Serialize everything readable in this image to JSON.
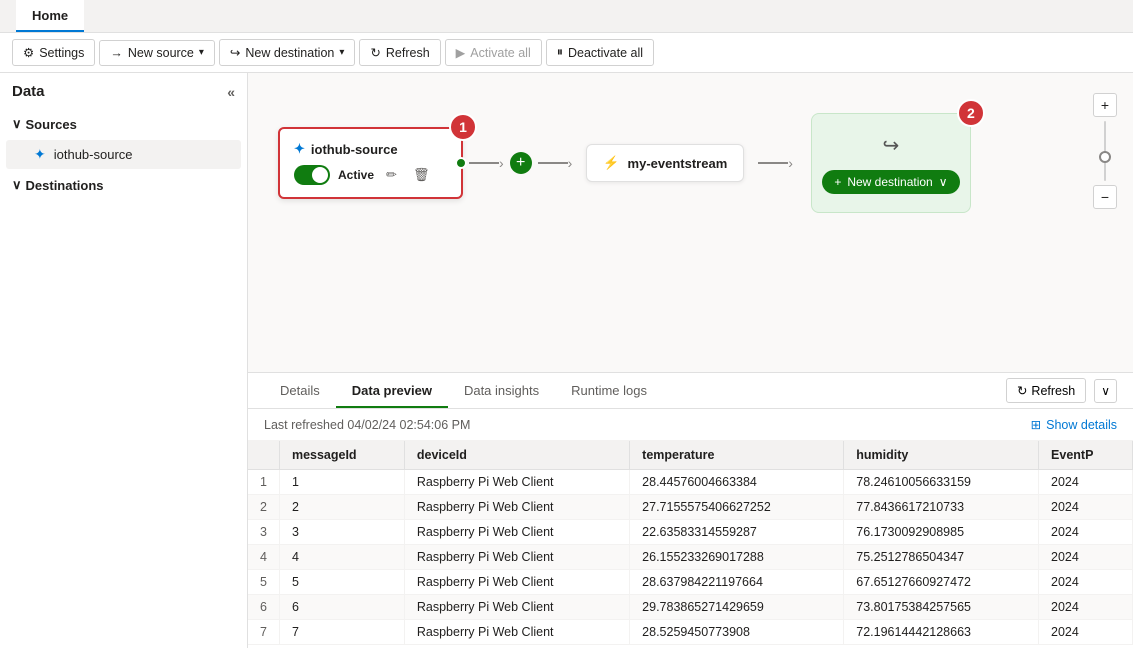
{
  "tab": {
    "label": "Home"
  },
  "toolbar": {
    "settings_label": "Settings",
    "new_source_label": "New source",
    "new_destination_label": "New destination",
    "refresh_label": "Refresh",
    "activate_all_label": "Activate all",
    "deactivate_all_label": "Deactivate all"
  },
  "sidebar": {
    "title": "Data",
    "sources_label": "Sources",
    "destinations_label": "Destinations",
    "source_item": "iothub-source"
  },
  "canvas": {
    "source_node": {
      "title": "iothub-source",
      "status": "Active",
      "step": "1"
    },
    "eventstream_node": {
      "title": "my-eventstream"
    },
    "destination_node": {
      "new_dest_label": "New destination"
    },
    "step2_label": "2"
  },
  "bottom_panel": {
    "tabs": [
      "Details",
      "Data preview",
      "Data insights",
      "Runtime logs"
    ],
    "active_tab": "Data preview",
    "refresh_label": "Refresh",
    "show_details_label": "Show details",
    "last_refreshed": "Last refreshed  04/02/24 02:54:06 PM",
    "columns": [
      "messageId",
      "deviceId",
      "temperature",
      "humidity",
      "EventP"
    ],
    "rows": [
      {
        "messageId": "1",
        "deviceId": "Raspberry Pi Web Client",
        "temperature": "28.44576004663384",
        "humidity": "78.24610056633159",
        "eventP": "2024"
      },
      {
        "messageId": "2",
        "deviceId": "Raspberry Pi Web Client",
        "temperature": "27.7155575406627252",
        "humidity": "77.8436617210733",
        "eventP": "2024"
      },
      {
        "messageId": "3",
        "deviceId": "Raspberry Pi Web Client",
        "temperature": "22.63583314559287",
        "humidity": "76.1730092908985",
        "eventP": "2024"
      },
      {
        "messageId": "4",
        "deviceId": "Raspberry Pi Web Client",
        "temperature": "26.155233269017288",
        "humidity": "75.2512786504347",
        "eventP": "2024"
      },
      {
        "messageId": "5",
        "deviceId": "Raspberry Pi Web Client",
        "temperature": "28.637984221197664",
        "humidity": "67.65127660927472",
        "eventP": "2024"
      },
      {
        "messageId": "6",
        "deviceId": "Raspberry Pi Web Client",
        "temperature": "29.783865271429659",
        "humidity": "73.80175384257565",
        "eventP": "2024"
      },
      {
        "messageId": "7",
        "deviceId": "Raspberry Pi Web Client",
        "temperature": "28.5259450773908",
        "humidity": "72.19614442128663",
        "eventP": "2024"
      }
    ]
  }
}
